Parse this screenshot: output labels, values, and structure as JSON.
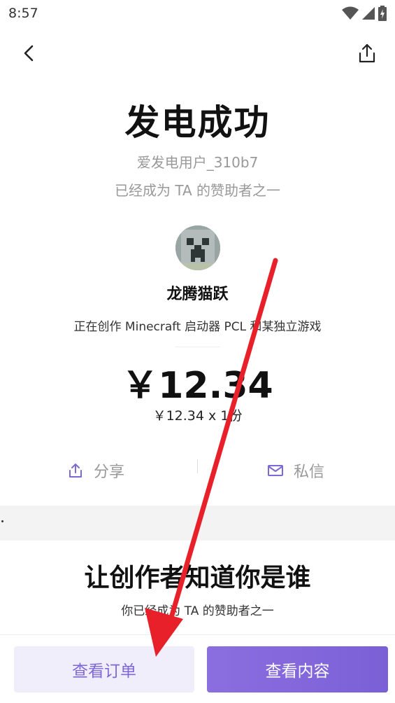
{
  "status_bar": {
    "time": "8:57",
    "icons": [
      "wifi-icon",
      "cellular-signal-icon",
      "battery-charging-icon"
    ]
  },
  "nav": {
    "back_icon": "chevron-left-icon",
    "share_icon": "share-upload-icon"
  },
  "hero": {
    "title": "发电成功",
    "username": "爱发电用户_310b7",
    "status": "已经成为 TA 的赞助者之一"
  },
  "creator": {
    "name": "龙腾猫跃",
    "description": "正在创作 Minecraft 启动器 PCL 和某独立游戏"
  },
  "payment": {
    "amount": "￥12.34",
    "detail": "￥12.34 x 1份"
  },
  "actions": {
    "share_label": "分享",
    "message_label": "私信"
  },
  "section": {
    "title": "让创作者知道你是谁",
    "subtitle": "你已经成为 TA 的赞助者之一"
  },
  "buttons": {
    "orders_label": "查看订单",
    "content_label": "查看内容"
  },
  "colors": {
    "accent": "#7b5fd6",
    "accent_light": "#f1eefb",
    "muted_text": "#999999",
    "annotation_arrow": "#e8202a"
  }
}
